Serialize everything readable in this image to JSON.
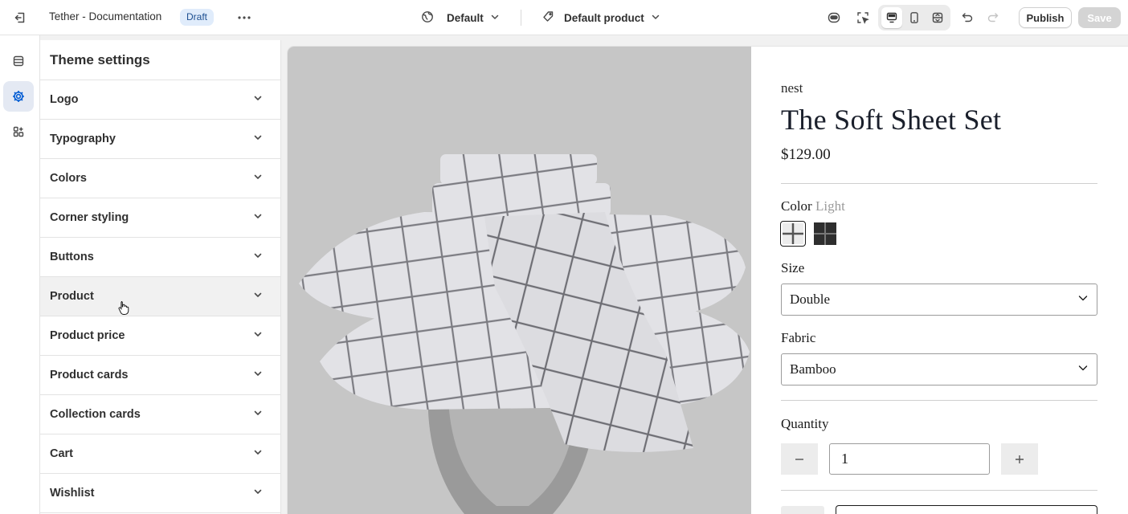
{
  "topbar": {
    "title": "Tether - Documentation",
    "status_badge": "Draft",
    "theme_selector": "Default",
    "template_selector": "Default product",
    "publish_label": "Publish",
    "save_label": "Save"
  },
  "rail": {
    "items": [
      {
        "icon": "sections-icon",
        "active": false
      },
      {
        "icon": "gear-icon",
        "active": true
      },
      {
        "icon": "apps-icon",
        "active": false
      }
    ]
  },
  "panel": {
    "title": "Theme settings",
    "items": [
      {
        "label": "Logo"
      },
      {
        "label": "Typography"
      },
      {
        "label": "Colors"
      },
      {
        "label": "Corner styling"
      },
      {
        "label": "Buttons"
      },
      {
        "label": "Product"
      },
      {
        "label": "Product price"
      },
      {
        "label": "Product cards"
      },
      {
        "label": "Collection cards"
      },
      {
        "label": "Cart"
      },
      {
        "label": "Wishlist"
      }
    ]
  },
  "product": {
    "vendor": "nest",
    "title": "The Soft Sheet Set",
    "price": "$129.00",
    "color_label": "Color",
    "color_value": "Light",
    "size_label": "Size",
    "size_value": "Double",
    "fabric_label": "Fabric",
    "fabric_value": "Bamboo",
    "quantity_label": "Quantity",
    "quantity_value": "1"
  },
  "colors": {
    "accent": "#005bd3",
    "draft_badge_bg": "#e0ecfb",
    "hover_row_bg": "#f1f1f1",
    "media_bg": "#c6c6c6"
  }
}
